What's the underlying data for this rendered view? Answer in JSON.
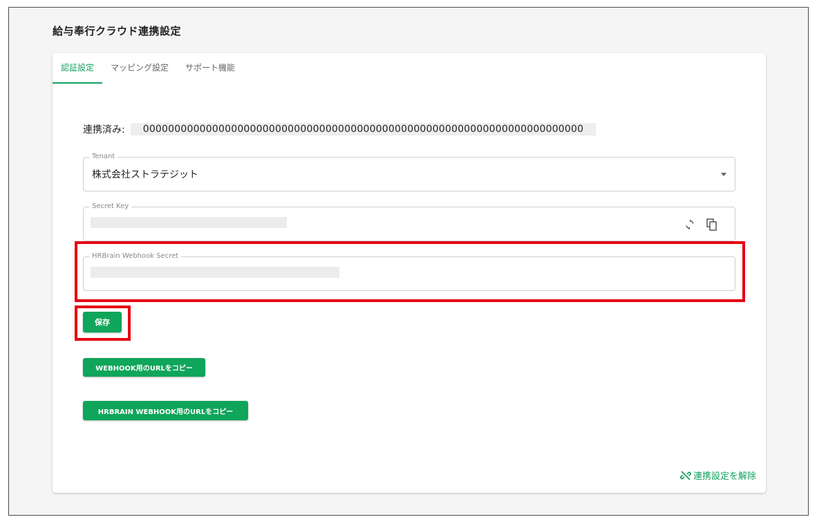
{
  "page": {
    "title": "給与奉行クラウド連携設定"
  },
  "tabs": [
    {
      "label": "認証設定",
      "active": true
    },
    {
      "label": "マッピング設定",
      "active": false
    },
    {
      "label": "サポート機能",
      "active": false
    }
  ],
  "auth": {
    "linked_label": "連携済み:",
    "linked_value": "0000000000000000000000000000000000000000000000000000000000000000000000",
    "tenant": {
      "label": "Tenant",
      "value": "株式会社ストラテジット"
    },
    "secret_key": {
      "label": "Secret Key"
    },
    "webhook_secret": {
      "label": "HRBrain Webhook Secret"
    },
    "save_label": "保存",
    "copy_webhook_url_label": "WEBHOOK用のURLをコピー",
    "copy_hrbrain_webhook_url_label": "HRBRAIN WEBHOOK用のURLをコピー",
    "unlink_label": "連携設定を解除"
  },
  "colors": {
    "accent": "#12a05c",
    "highlight": "#e50012"
  },
  "icons": {
    "refresh": "refresh-icon",
    "copy": "copy-icon",
    "unlink": "link-off-icon",
    "dropdown": "chevron-down-icon"
  }
}
